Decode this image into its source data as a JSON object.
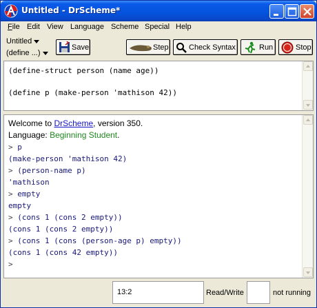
{
  "window": {
    "title": "Untitled - DrScheme*"
  },
  "menu": [
    "File",
    "Edit",
    "View",
    "Language",
    "Scheme",
    "Special",
    "Help"
  ],
  "menu_underline": [
    "F",
    "E",
    "V",
    "L",
    "S",
    "S",
    "H"
  ],
  "toolbar": {
    "file_name": "Untitled",
    "define_label": "(define ...)",
    "save_label": "Save",
    "step_label": "Step",
    "check_syntax_label": "Check Syntax",
    "run_label": "Run",
    "stop_label": "Stop"
  },
  "definitions": {
    "lines": [
      "(define-struct person (name age))",
      "",
      "(define p (make-person 'mathison 42))"
    ]
  },
  "interactions": {
    "welcome_prefix": "Welcome to ",
    "welcome_link": "DrScheme",
    "welcome_suffix": ", version 350.",
    "language_prefix": "Language: ",
    "language_name": "Beginning Student",
    "language_suffix": ".",
    "lines": [
      {
        "prompt": "> ",
        "text": "p",
        "kind": "input"
      },
      {
        "prompt": "",
        "text": "(make-person 'mathison 42)",
        "kind": "output"
      },
      {
        "prompt": "> ",
        "text": "(person-name p)",
        "kind": "input"
      },
      {
        "prompt": "",
        "text": "'mathison",
        "kind": "output"
      },
      {
        "prompt": "> ",
        "text": "empty",
        "kind": "input"
      },
      {
        "prompt": "",
        "text": "empty",
        "kind": "output"
      },
      {
        "prompt": "> ",
        "text": "(cons 1 (cons 2 empty))",
        "kind": "input"
      },
      {
        "prompt": "",
        "text": "(cons 1 (cons 2 empty))",
        "kind": "output"
      },
      {
        "prompt": "> ",
        "text": "(cons 1 (cons (person-age p) empty))",
        "kind": "input"
      },
      {
        "prompt": "",
        "text": "(cons 1 (cons 42 empty))",
        "kind": "output"
      },
      {
        "prompt": "> ",
        "text": "",
        "kind": "input"
      }
    ]
  },
  "status": {
    "position": "13:2",
    "mode": "Read/Write",
    "running": "not running"
  },
  "colors": {
    "titlebar": "#0553dd",
    "output_text": "#17177a",
    "language_green": "#1f8a1f",
    "link_blue": "#1313c8"
  }
}
